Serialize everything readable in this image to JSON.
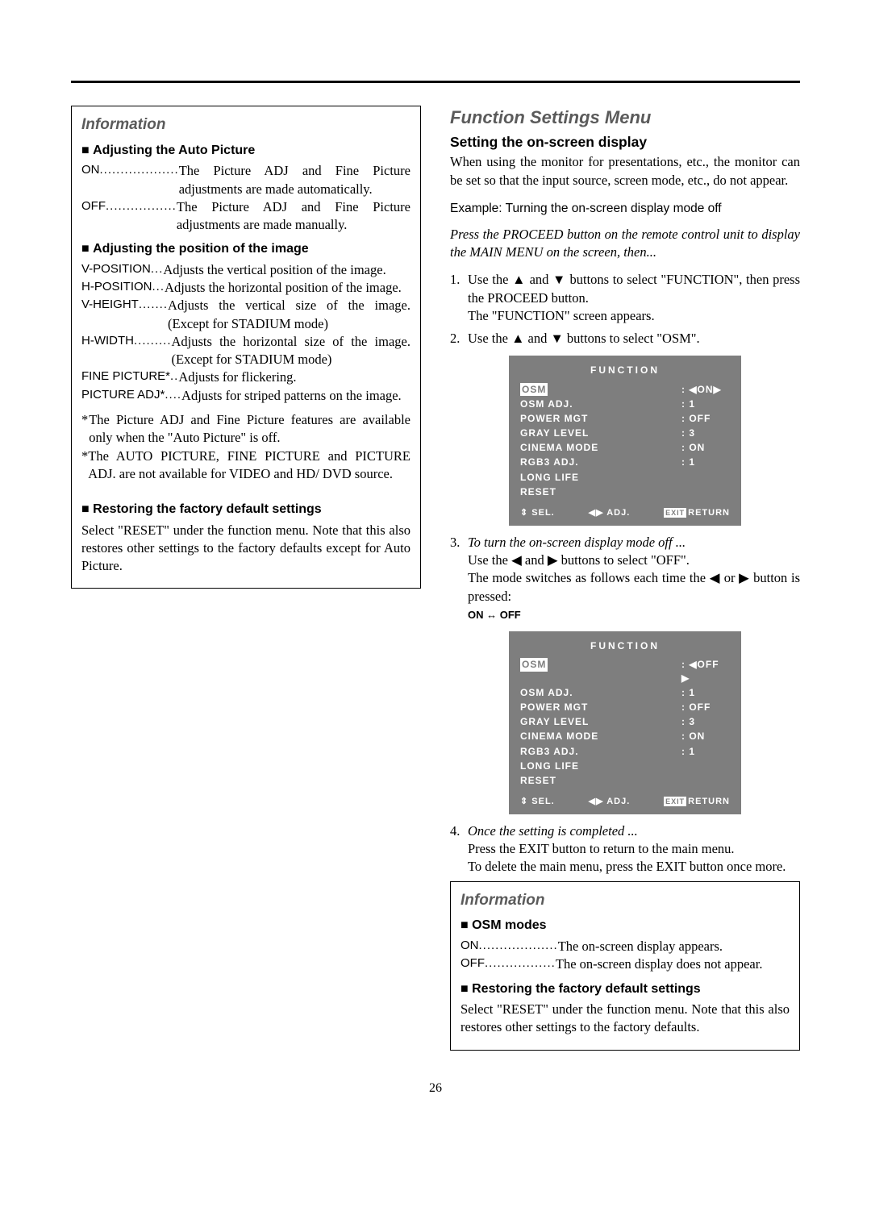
{
  "page_number": "26",
  "left": {
    "info_title": "Information",
    "auto_picture": {
      "heading": "Adjusting the Auto Picture",
      "on_term": "ON",
      "on_dots": "...................",
      "on_def": "The Picture ADJ and Fine Picture adjustments are made automatically.",
      "off_term": "OFF",
      "off_dots": ".................",
      "off_def": "The Picture ADJ and Fine Picture adjustments are made manually."
    },
    "position": {
      "heading": "Adjusting the position of the image",
      "items": [
        {
          "term": "V-POSITION",
          "dots": " ... ",
          "def": "Adjusts the vertical position of the image."
        },
        {
          "term": "H-POSITION",
          "dots": " ... ",
          "def": "Adjusts the horizontal position of the image."
        },
        {
          "term": "V-HEIGHT",
          "dots": " ....... ",
          "def": "Adjusts the vertical size of the image. (Except for STADIUM mode)"
        },
        {
          "term": "H-WIDTH",
          "dots": " ......... ",
          "def": "Adjusts the horizontal size of the image. (Except for STADIUM mode)"
        },
        {
          "term": "FINE PICTURE*",
          "dots": ".. ",
          "def": "Adjusts for flickering."
        },
        {
          "term": "PICTURE ADJ*",
          "dots": ".... ",
          "def": "Adjusts for striped patterns on the image."
        }
      ],
      "note1_star": "*",
      "note1": "The Picture ADJ and Fine Picture features are available only when the \"Auto Picture\" is off.",
      "note2_star": "*",
      "note2": "The AUTO PICTURE, FINE PICTURE and PICTURE ADJ. are not available for VIDEO and HD/ DVD source."
    },
    "restore": {
      "heading": "Restoring the factory default settings",
      "body": "Select \"RESET\" under the function menu. Note that this also restores other settings to the factory defaults except for Auto Picture."
    }
  },
  "right": {
    "section_title": "Function Settings Menu",
    "subhead": "Setting the on-screen display",
    "intro": "When using the monitor for presentations, etc., the monitor can be set so that the input source, screen mode, etc., do not appear.",
    "example": "Example: Turning the on-screen display mode off",
    "preamble": "Press the PROCEED button on the remote control unit to display the MAIN MENU on the screen, then...",
    "step1_num": "1.",
    "step1a": "Use the ▲ and ▼ buttons to select \"FUNCTION\", then press the PROCEED button.",
    "step1b": "The \"FUNCTION\" screen appears.",
    "step2_num": "2.",
    "step2": "Use the ▲ and ▼ buttons to select \"OSM\".",
    "osd1": {
      "title": "FUNCTION",
      "rows": [
        {
          "label": "OSM",
          "val": ": ◀ON▶",
          "selected": true
        },
        {
          "label": "OSM ADJ.",
          "val": ":  1"
        },
        {
          "label": "POWER MGT",
          "val": ":  OFF"
        },
        {
          "label": "GRAY LEVEL",
          "val": ":  3"
        },
        {
          "label": "CINEMA MODE",
          "val": ":  ON"
        },
        {
          "label": "RGB3 ADJ.",
          "val": ":  1"
        },
        {
          "label": "LONG LIFE",
          "val": ""
        },
        {
          "label": "RESET",
          "val": ""
        }
      ],
      "footer": {
        "sel": "SEL.",
        "adj": "ADJ.",
        "ret": "RETURN",
        "exit": "EXIT"
      }
    },
    "step3_num": "3.",
    "step3_title": "To turn the on-screen display mode off ...",
    "step3a": "Use the ◀ and ▶ buttons to select \"OFF\".",
    "step3b": "The mode switches as follows each time the ◀ or ▶ button is pressed:",
    "toggle": "ON ↔ OFF",
    "osd2": {
      "title": "FUNCTION",
      "rows": [
        {
          "label": "OSM",
          "val": ": ◀OFF ▶",
          "selected": true
        },
        {
          "label": "OSM ADJ.",
          "val": ":  1"
        },
        {
          "label": "POWER MGT",
          "val": ":  OFF"
        },
        {
          "label": "GRAY LEVEL",
          "val": ":  3"
        },
        {
          "label": "CINEMA MODE",
          "val": ":  ON"
        },
        {
          "label": "RGB3 ADJ.",
          "val": ":  1"
        },
        {
          "label": "LONG LIFE",
          "val": ""
        },
        {
          "label": "RESET",
          "val": ""
        }
      ],
      "footer": {
        "sel": "SEL.",
        "adj": "ADJ.",
        "ret": "RETURN",
        "exit": "EXIT"
      }
    },
    "step4_num": "4.",
    "step4_title": "Once the setting is completed ...",
    "step4a": "Press the EXIT button to return to the main menu.",
    "step4b": "To delete the main menu, press the EXIT button once more.",
    "info2": {
      "title": "Information",
      "osm_heading": "OSM modes",
      "on_term": "ON",
      "on_dots": "...................",
      "on_def": "The on-screen display appears.",
      "off_term": "OFF",
      "off_dots": ".................",
      "off_def": "The on-screen display does not appear.",
      "restore_heading": "Restoring the factory default settings",
      "restore_body": "Select \"RESET\" under the function menu. Note that this also restores other settings to the factory defaults."
    }
  }
}
